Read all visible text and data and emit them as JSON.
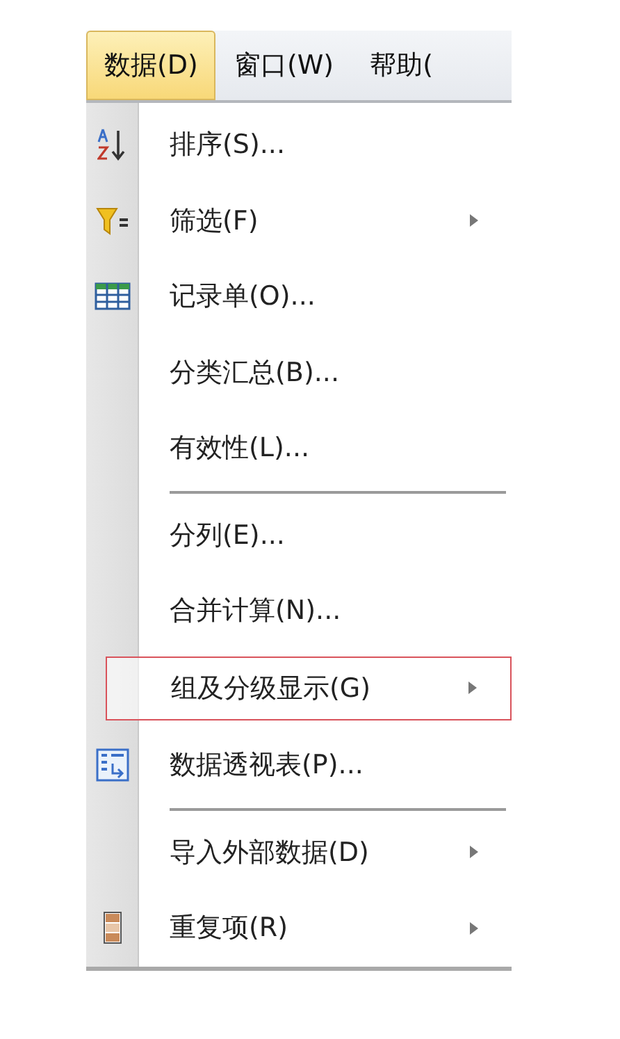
{
  "menu_bar": [
    {
      "label": "数据(D)",
      "selected": true
    },
    {
      "label": "窗口(W)",
      "selected": false
    },
    {
      "label": "帮助(",
      "selected": false
    }
  ],
  "menu_items": [
    {
      "kind": "item",
      "label": "排序(S)...",
      "submenu": false,
      "highlighted": false
    },
    {
      "kind": "item",
      "label": "筛选(F)",
      "submenu": true,
      "highlighted": false
    },
    {
      "kind": "item",
      "label": "记录单(O)...",
      "submenu": false,
      "highlighted": false
    },
    {
      "kind": "item",
      "label": "分类汇总(B)...",
      "submenu": false,
      "highlighted": false
    },
    {
      "kind": "item",
      "label": "有效性(L)...",
      "submenu": false,
      "highlighted": false
    },
    {
      "kind": "separator"
    },
    {
      "kind": "item",
      "label": "分列(E)...",
      "submenu": false,
      "highlighted": false
    },
    {
      "kind": "item",
      "label": "合并计算(N)...",
      "submenu": false,
      "highlighted": false
    },
    {
      "kind": "item",
      "label": "组及分级显示(G)",
      "submenu": true,
      "highlighted": true
    },
    {
      "kind": "item",
      "label": "数据透视表(P)...",
      "submenu": false,
      "highlighted": false
    },
    {
      "kind": "separator"
    },
    {
      "kind": "item",
      "label": "导入外部数据(D)",
      "submenu": true,
      "highlighted": false
    },
    {
      "kind": "item",
      "label": "重复项(R)",
      "submenu": true,
      "highlighted": false
    }
  ]
}
